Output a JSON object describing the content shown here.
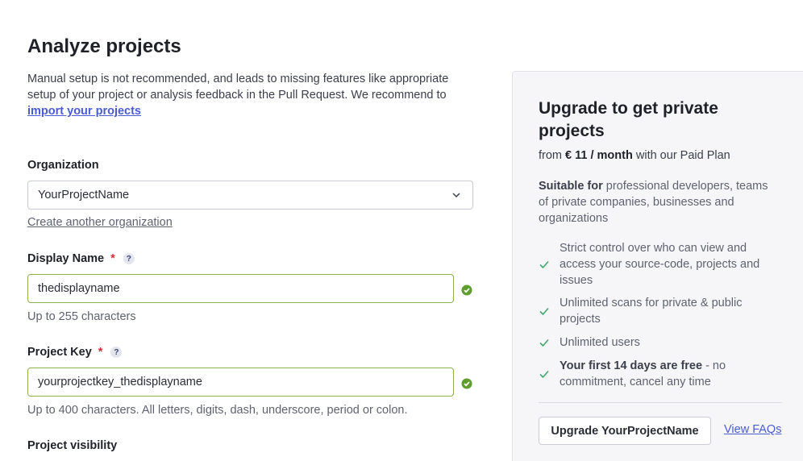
{
  "page": {
    "title": "Analyze projects",
    "intro_text": "Manual setup is not recommended, and leads to missing features like appropriate setup of your project or analysis feedback in the Pull Request. We recommend to ",
    "intro_link": "import your projects"
  },
  "form": {
    "organization": {
      "label": "Organization",
      "value": "YourProjectName",
      "create_link": "Create another organization"
    },
    "display_name": {
      "label": "Display Name",
      "required_mark": "*",
      "help": "?",
      "value": "thedisplayname",
      "hint": "Up to 255 characters"
    },
    "project_key": {
      "label": "Project Key",
      "required_mark": "*",
      "help": "?",
      "value": "yourprojectkey_thedisplayname",
      "hint": "Up to 400 characters. All letters, digits, dash, underscore, period or colon."
    },
    "visibility": {
      "label": "Project visibility"
    }
  },
  "upgrade_card": {
    "title": "Upgrade to get private projects",
    "price_prefix": "from ",
    "price": "€ 11 / month",
    "price_suffix": " with our Paid Plan",
    "desc_bold": "Suitable for",
    "desc_text": " professional developers, teams of private companies, businesses and organizations",
    "features": [
      {
        "bold": "",
        "text": "Strict control over who can view and access your source-code, projects and issues"
      },
      {
        "bold": "",
        "text": "Unlimited scans for private & public projects"
      },
      {
        "bold": "",
        "text": "Unlimited users"
      },
      {
        "bold": "Your first 14 days are free",
        "text": " - no commitment, cancel any time"
      }
    ],
    "upgrade_button": "Upgrade YourProjectName",
    "faq_link": "View FAQs"
  },
  "colors": {
    "accent_link": "#4b5bd1",
    "valid_border": "#8ab24a",
    "check_green": "#5d9e2e",
    "feature_check": "#3fa86b",
    "required": "#d02f3a"
  },
  "icons": {
    "select_chevron": "chevron-down-icon",
    "field_valid": "check-circle-icon",
    "feature_check": "checkmark-icon",
    "help": "help-icon"
  }
}
